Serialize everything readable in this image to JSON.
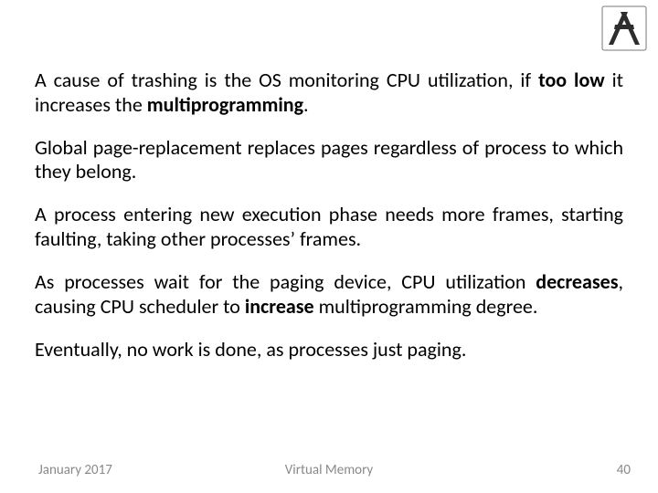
{
  "paragraphs": {
    "p1": {
      "t1": "A cause of trashing is the OS monitoring CPU utilization, if ",
      "b1": "too low",
      "t2": " it increases the ",
      "b2": "multiprogramming",
      "t3": "."
    },
    "p2": "Global page-replacement replaces pages regardless of process to which they belong.",
    "p3": "A process entering new execution phase needs more frames, starting faulting, taking other processes’ frames.",
    "p4": {
      "t1": "As processes wait for the paging device, CPU utilization ",
      "b1": "decreases",
      "t2": ", causing CPU scheduler to ",
      "b2": "increase",
      "t3": " multiprogramming degree."
    },
    "p5": "Eventually, no work is done, as processes just paging."
  },
  "footer": {
    "date": "January 2017",
    "title": "Virtual Memory",
    "page": "40"
  }
}
